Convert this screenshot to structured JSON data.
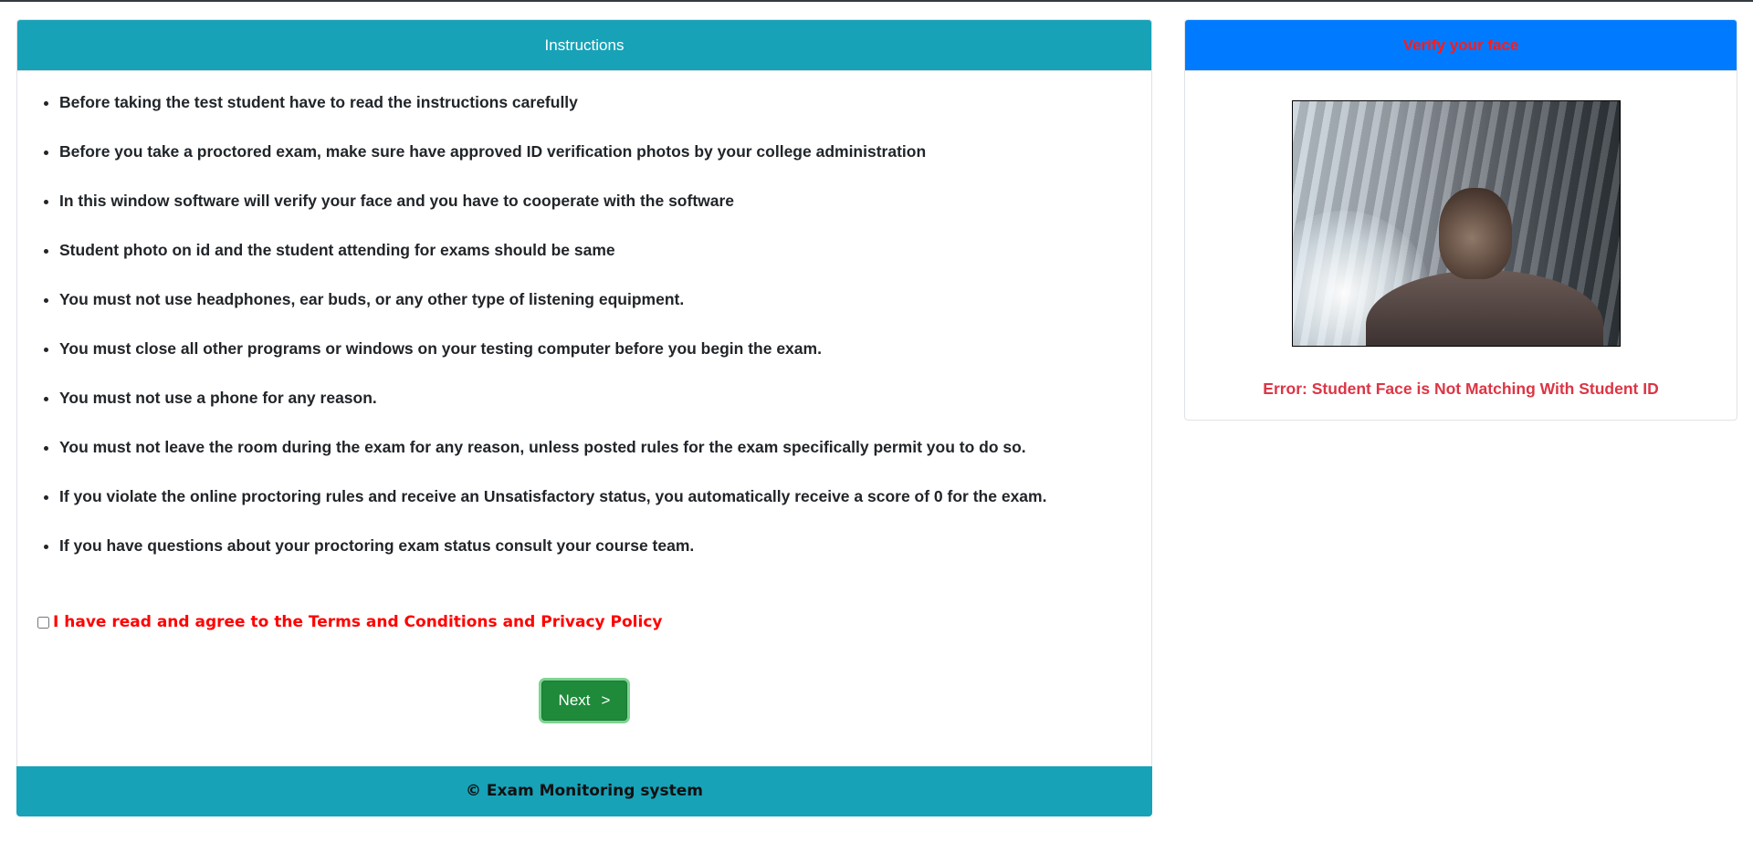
{
  "instructions_card": {
    "header_title": "Instructions",
    "items": [
      "Before taking the test student have to read the instructions carefully",
      "Before you take a proctored exam, make sure have approved ID verification photos by your college administration",
      "In this window software will verify your face and you have to cooperate with the software",
      "Student photo on id and the student attending for exams should be same",
      "You must not use headphones, ear buds, or any other type of listening equipment.",
      "You must close all other programs or windows on your testing computer before you begin the exam.",
      "You must not use a phone for any reason.",
      "You must not leave the room during the exam for any reason, unless posted rules for the exam specifically permit you to do so.",
      "If you violate the online proctoring rules and receive an Unsatisfactory status, you automatically receive a score of 0 for the exam.",
      "If you have questions about your proctoring exam status consult your course team."
    ],
    "agree_label": "I have read and agree to the Terms and Conditions and Privacy Policy",
    "agree_checked": false,
    "next_button": {
      "label": "Next",
      "chevron": ">"
    },
    "footer_text": "© Exam Monitoring system"
  },
  "verify_card": {
    "header_title": "Verify your face",
    "error_text": "Error: Student Face is Not Matching With Student ID"
  },
  "colors": {
    "instructions_header": "#17a2b8",
    "verify_header": "#007bff",
    "verify_title_text": "#ff1a1a",
    "error_text": "#dc3545",
    "agree_text": "#ff0000",
    "next_button": "#1e8a3a"
  }
}
